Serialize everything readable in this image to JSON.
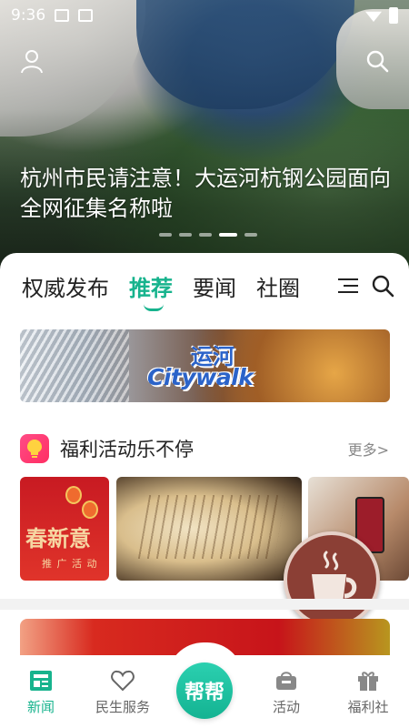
{
  "status_bar": {
    "time": "9:36"
  },
  "hero": {
    "title": "杭州市民请注意！大运河杭钢公园面向全网征集名称啦",
    "slide_count": 5,
    "active_slide": 4
  },
  "tabs": [
    {
      "label": "权威发布",
      "active": false
    },
    {
      "label": "推荐",
      "active": true
    },
    {
      "label": "要闻",
      "active": false
    },
    {
      "label": "社圈",
      "active": false
    }
  ],
  "banner": {
    "logo_top": "运河",
    "logo_bottom": "Citywalk"
  },
  "welfare_section": {
    "title": "福利活动乐不停",
    "more_label": "更多>",
    "card1_title": "春新意",
    "card1_subtitle": "推 广 活 动"
  },
  "bottom_nav": {
    "items": [
      {
        "label": "新闻",
        "icon": "newspaper-icon",
        "active": true
      },
      {
        "label": "民生服务",
        "icon": "heart-icon",
        "active": false
      },
      {
        "label": "帮帮",
        "icon": "help-center-button",
        "active": false
      },
      {
        "label": "活动",
        "icon": "gift-bag-icon",
        "active": false
      },
      {
        "label": "福利社",
        "icon": "gift-box-icon",
        "active": false
      }
    ]
  },
  "colors": {
    "accent": "#17b38d",
    "welfare_icon": "#ff2e63",
    "coffee": "#8b3f35"
  }
}
